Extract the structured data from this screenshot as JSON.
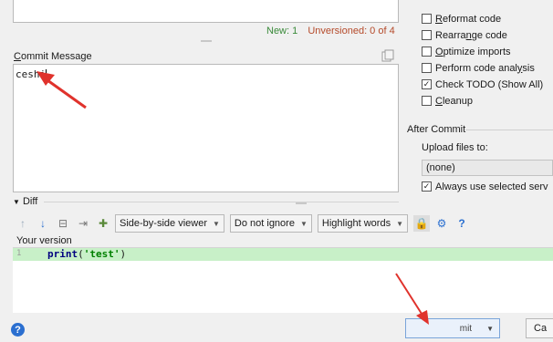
{
  "changes": {
    "new_count": "New: 1",
    "unversioned": "Unversioned: 0 of 4"
  },
  "commit_message": {
    "label_prefix": "C",
    "label_rest": "ommit Message",
    "value": "ceshi"
  },
  "options": [
    {
      "pre": "",
      "u": "R",
      "post": "eformat code",
      "checked": false
    },
    {
      "pre": "Rearra",
      "u": "n",
      "post": "ge code",
      "checked": false
    },
    {
      "pre": "",
      "u": "O",
      "post": "ptimize imports",
      "checked": false
    },
    {
      "pre": "Perform code anal",
      "u": "y",
      "post": "sis",
      "checked": false
    },
    {
      "pre": "Check TODO (Show All)",
      "u": "",
      "post": "",
      "checked": true
    },
    {
      "pre": "",
      "u": "C",
      "post": "leanup",
      "checked": false
    }
  ],
  "after_commit": {
    "title": "After Commit",
    "upload_label": "Upload files to:",
    "upload_value": "(none)",
    "always_use": "Always use selected serv",
    "always_use_checked": true
  },
  "diff": {
    "header": "Diff",
    "viewer": "Side-by-side viewer",
    "ignore": "Do not ignore",
    "highlight": "Highlight words",
    "your_version": "Your version",
    "line_number": "1",
    "code_keyword": "print",
    "code_open": "(",
    "code_string": "'test'",
    "code_close": ")"
  },
  "buttons": {
    "help": "?",
    "commit": "mit",
    "cancel": "Ca"
  },
  "colors": {
    "annotation": "#e0322c",
    "diff_added": "#c8f0c8"
  }
}
